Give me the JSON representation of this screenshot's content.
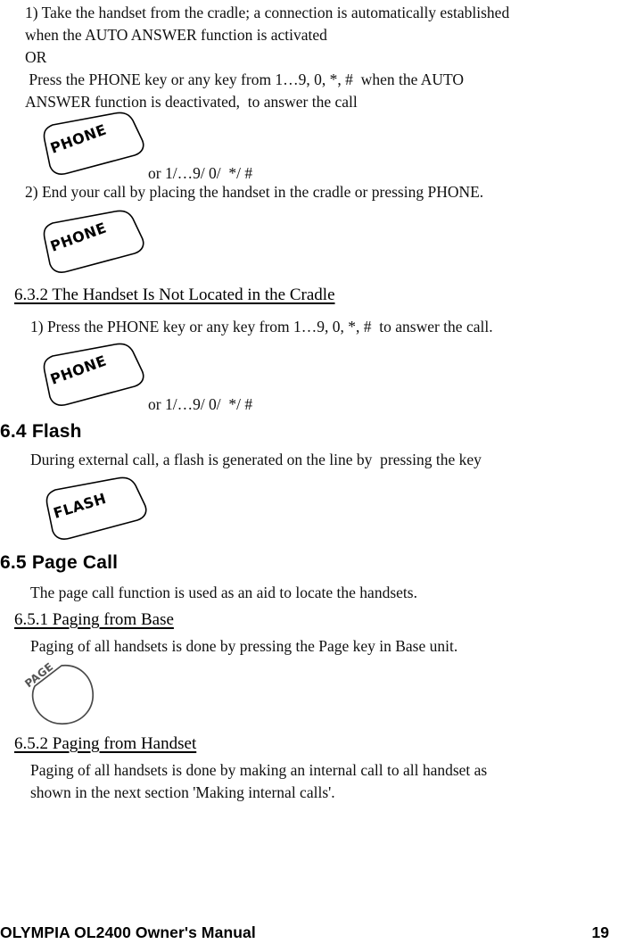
{
  "document": {
    "footer_title": "OLYMPIA  OL2400 Owner's Manual",
    "page_number": "19"
  },
  "content": {
    "step_1_paragraph": "1) Take the handset from the cradle; a connection is automatically established\nwhen the AUTO ANSWER function is activated\nOR\n Press the PHONE key or any key from 1…9, 0, *, #  when the AUTO\nANSWER function is deactivated,  to answer the call",
    "or_keys_note_1": "or 1/…9/ 0/  */ #",
    "step_2_paragraph": "2) End your call by placing the handset in the cradle or pressing PHONE.",
    "section_632_heading": "6.3.2  The Handset Is Not Located in the Cradle",
    "section_632_step_1": "1) Press the PHONE key or any key from 1…9, 0, *, #  to answer the call.",
    "or_keys_note_2": "or 1/…9/ 0/  */ #",
    "section_64_heading": "6.4  Flash",
    "section_64_body": "During external call, a flash is generated on the line by  pressing the key",
    "section_65_heading": "6.5  Page Call",
    "section_65_body": "The page call function is used as an aid to locate the handsets.",
    "section_651_heading": "6.5.1  Paging from Base",
    "section_651_body": "Paging of all handsets is done by pressing the Page key in Base unit.",
    "section_652_heading": "6.5.2  Paging from Handset",
    "section_652_body": "Paging of all handsets is done by making an internal call to all handset as\nshown in the next section 'Making internal calls'."
  },
  "graphics": {
    "phone_key_label": "PHONE",
    "flash_key_label": "FLASH",
    "page_key_label": "PAGE"
  },
  "colors": {
    "ink": "#000000",
    "page_background": "#ffffff",
    "grey_ink": "#555555"
  }
}
